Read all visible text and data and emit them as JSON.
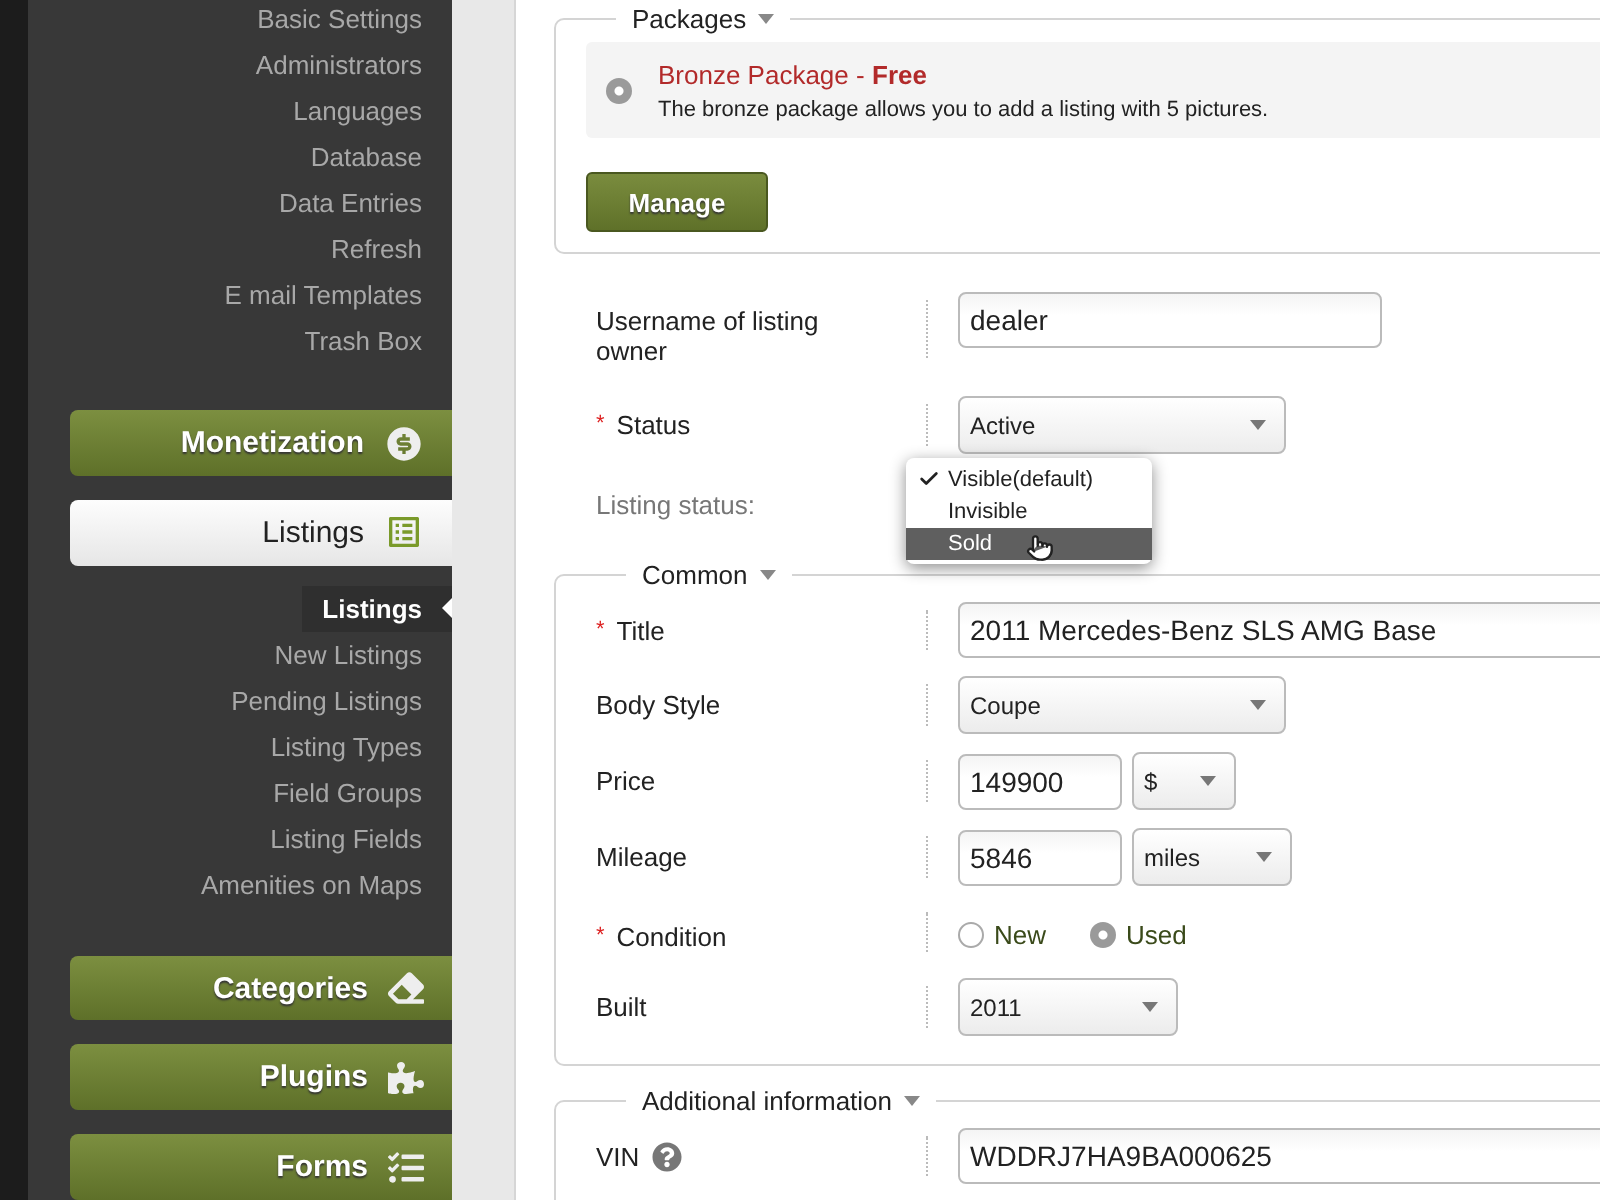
{
  "sidebar": {
    "top_links": [
      {
        "label": "Basic Settings",
        "selected": false
      },
      {
        "label": "Administrators",
        "selected": false
      },
      {
        "label": "Languages",
        "selected": false
      },
      {
        "label": "Database",
        "selected": false
      },
      {
        "label": "Data Entries",
        "selected": false
      },
      {
        "label": "Refresh",
        "selected": false
      },
      {
        "label": "E mail Templates",
        "selected": false
      },
      {
        "label": "Trash Box",
        "selected": false
      }
    ],
    "sections": [
      {
        "kind": "monetization",
        "label": "Monetization",
        "selected": false
      },
      {
        "kind": "listings",
        "label": "Listings",
        "selected": true,
        "items": [
          {
            "label": "Listings",
            "selected": true
          },
          {
            "label": "New Listings",
            "selected": false
          },
          {
            "label": "Pending Listings",
            "selected": false
          },
          {
            "label": "Listing Types",
            "selected": false
          },
          {
            "label": "Field Groups",
            "selected": false
          },
          {
            "label": "Listing Fields",
            "selected": false
          },
          {
            "label": "Amenities on Maps",
            "selected": false
          }
        ]
      },
      {
        "kind": "categories",
        "label": "Categories",
        "selected": false
      },
      {
        "kind": "plugins",
        "label": "Plugins",
        "selected": false
      },
      {
        "kind": "forms",
        "label": "Forms",
        "selected": false
      }
    ]
  },
  "packages": {
    "legend": "Packages",
    "package": {
      "name": "Bronze Package",
      "separator": "-",
      "price": "Free",
      "description": "The bronze package allows you to add a listing with 5 pictures.",
      "selected": true
    },
    "button": "Manage"
  },
  "owner_fields": [
    {
      "kind": "text",
      "label": "Username of listing owner",
      "value": "dealer"
    },
    {
      "kind": "select",
      "label": "Status",
      "required_mark": "*",
      "value": "Active"
    },
    {
      "kind": "menu",
      "label": "Listing status:",
      "options": [
        {
          "label": "Visible(default)",
          "selected": true,
          "hovered": false
        },
        {
          "label": "Invisible",
          "selected": false,
          "hovered": false
        },
        {
          "label": "Sold",
          "selected": false,
          "hovered": true
        }
      ]
    }
  ],
  "common": {
    "legend": "Common",
    "fields": [
      {
        "kind": "wide_text",
        "label": "Title",
        "required_mark": "*",
        "value": "2011 Mercedes-Benz SLS AMG Base"
      },
      {
        "kind": "select",
        "label": "Body Style",
        "value": "Coupe"
      },
      {
        "kind": "text_unit",
        "label": "Price",
        "value": "149900",
        "unit": "$"
      },
      {
        "kind": "text_unit",
        "label": "Mileage",
        "value": "5846",
        "unit": "miles"
      },
      {
        "kind": "radio",
        "label": "Condition",
        "required_mark": "*",
        "options": [
          {
            "label": "New",
            "selected": false
          },
          {
            "label": "Used",
            "selected": true
          }
        ]
      },
      {
        "kind": "short_select",
        "label": "Built",
        "value": "2011"
      }
    ]
  },
  "additional": {
    "legend": "Additional information",
    "fields": [
      {
        "kind": "wide_text",
        "label": "VIN",
        "help": true,
        "value": "WDDRJ7HA9BA000625"
      }
    ]
  }
}
